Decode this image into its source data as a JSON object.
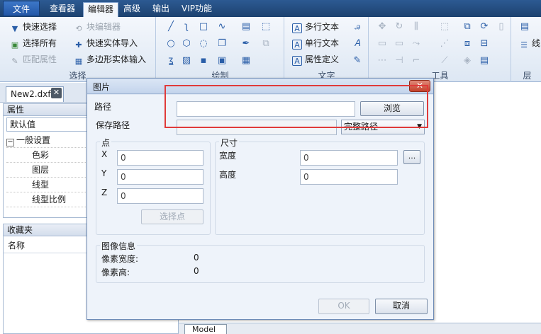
{
  "menubar": {
    "file": "文件",
    "items": [
      "查看器",
      "编辑器",
      "高级",
      "输出",
      "VIP功能"
    ],
    "active_index": 1
  },
  "ribbon": {
    "select_group": {
      "label": "选择",
      "quick_select": "快速选择",
      "block_editor": "块编辑器",
      "select_all": "选择所有",
      "quick_entity_import": "快速实体导入",
      "match_props": "匹配属性",
      "polygon_entity_input": "多边形实体输入"
    },
    "draw_group": {
      "label": "绘制"
    },
    "text_group": {
      "label": "文字",
      "multiline_text": "多行文本",
      "singleline_text": "单行文本",
      "attr_def": "属性定义"
    },
    "tools_group": {
      "label": "工具"
    },
    "layer_group": {
      "label": "层",
      "item_partial": "线"
    }
  },
  "tabs": {
    "doc_tab": "New2.dxf"
  },
  "properties_panel": {
    "title": "属性",
    "default_value": "默认值",
    "section": "一般设置",
    "rows": [
      "色彩",
      "图层",
      "线型",
      "线型比例"
    ]
  },
  "favorites_panel": {
    "title": "收藏夹",
    "column_name": "名称"
  },
  "model_tab": "Model",
  "dialog": {
    "title": "图片",
    "close_symbol": "✕",
    "path_label": "路径",
    "path_value": "",
    "browse_button": "浏览",
    "save_path_label": "保存路径",
    "save_path_value": "",
    "path_mode": "完整路径",
    "point_group": "点",
    "x_label": "X",
    "x_value": "0",
    "y_label": "Y",
    "y_value": "0",
    "z_label": "Z",
    "z_value": "0",
    "select_point_button": "选择点",
    "size_group": "尺寸",
    "width_label": "宽度",
    "width_value": "0",
    "height_label": "高度",
    "height_value": "0",
    "ellipsis_button": "...",
    "image_info_group": "图像信息",
    "pixel_width_label": "像素宽度:",
    "pixel_width_value": "0",
    "pixel_height_label": "像素高:",
    "pixel_height_value": "0",
    "ok_button": "OK",
    "cancel_button": "取消"
  },
  "colors": {
    "menubar": "#1d426f",
    "highlight": "#e03a3a",
    "dialog_close": "#c4402a"
  }
}
